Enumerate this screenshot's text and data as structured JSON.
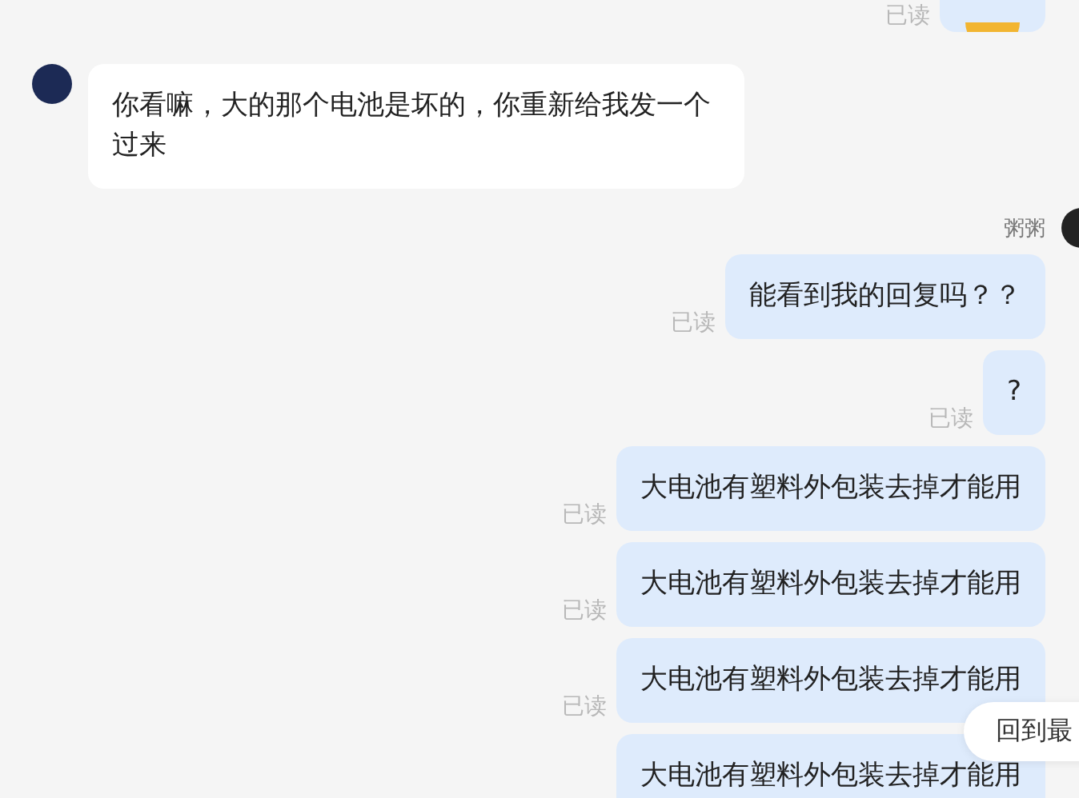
{
  "messages": [
    {
      "kind": "sticker",
      "status": "已读"
    },
    {
      "kind": "incoming",
      "text": "你看嘛，大的那个电池是坏的，你重新给我发一个过来"
    },
    {
      "kind": "sender",
      "name": "粥粥"
    },
    {
      "kind": "outgoing",
      "status": "已读",
      "text": "能看到我的回复吗？？"
    },
    {
      "kind": "outgoing",
      "status": "已读",
      "text": "?"
    },
    {
      "kind": "outgoing",
      "status": "已读",
      "text": "大电池有塑料外包装去掉才能用"
    },
    {
      "kind": "outgoing",
      "status": "已读",
      "text": "大电池有塑料外包装去掉才能用"
    },
    {
      "kind": "outgoing",
      "status": "已读",
      "text": "大电池有塑料外包装去掉才能用"
    },
    {
      "kind": "outgoing",
      "text": "大电池有塑料外包装去掉才能用"
    }
  ],
  "scroll_button": {
    "label": "回到最"
  }
}
